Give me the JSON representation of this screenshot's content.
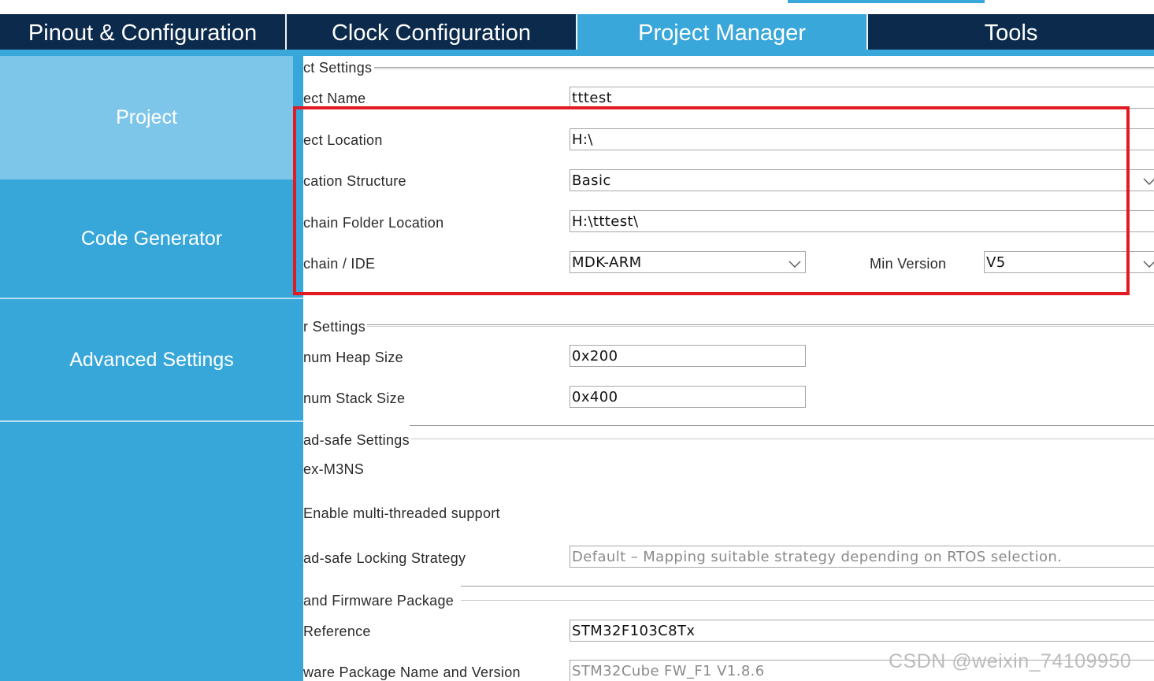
{
  "tabs": [
    {
      "label": "Pinout & Configuration",
      "active": false
    },
    {
      "label": "Clock Configuration",
      "active": false
    },
    {
      "label": "Project Manager",
      "active": true
    },
    {
      "label": "Tools",
      "active": false
    }
  ],
  "sidebar": {
    "items": [
      {
        "label": "Project",
        "active": true
      },
      {
        "label": "Code Generator",
        "active": false
      },
      {
        "label": "Advanced Settings",
        "active": false
      }
    ]
  },
  "project_settings": {
    "legend": "ct Settings",
    "name_label": "ect Name",
    "name_value": "tttest",
    "location_label": "ect Location",
    "location_value": "H:\\",
    "structure_label": "cation Structure",
    "structure_value": "Basic",
    "toolchain_folder_label": "chain Folder Location",
    "toolchain_folder_value": "H:\\tttest\\",
    "toolchain_label": "chain / IDE",
    "toolchain_value": "MDK-ARM",
    "min_version_label": "Min Version",
    "min_version_value": "V5"
  },
  "linker_settings": {
    "legend": "r Settings",
    "heap_label": "num Heap Size",
    "heap_value": "0x200",
    "stack_label": "num Stack Size",
    "stack_value": "0x400"
  },
  "thread_safe": {
    "legend": "ad-safe Settings",
    "core": "ex-M3NS",
    "multithread_label": "Enable multi-threaded support",
    "strategy_label": "ad-safe Locking Strategy",
    "strategy_value": "Default – Mapping suitable strategy depending on RTOS selection."
  },
  "mcu_package": {
    "legend": "and Firmware Package",
    "reference_label": "Reference",
    "reference_value": "STM32F103C8Tx",
    "package_label": "ware Package Name and Version",
    "package_value": "STM32Cube FW_F1 V1.8.6"
  },
  "watermark": "CSDN @weixin_74109950",
  "colors": {
    "tab_bar": "#0c2a4c",
    "accent": "#3aa7db",
    "sidebar_active": "#7dc6e9",
    "highlight": "#e01b22"
  },
  "icons": {
    "dropdown": "chevron-down-icon"
  }
}
